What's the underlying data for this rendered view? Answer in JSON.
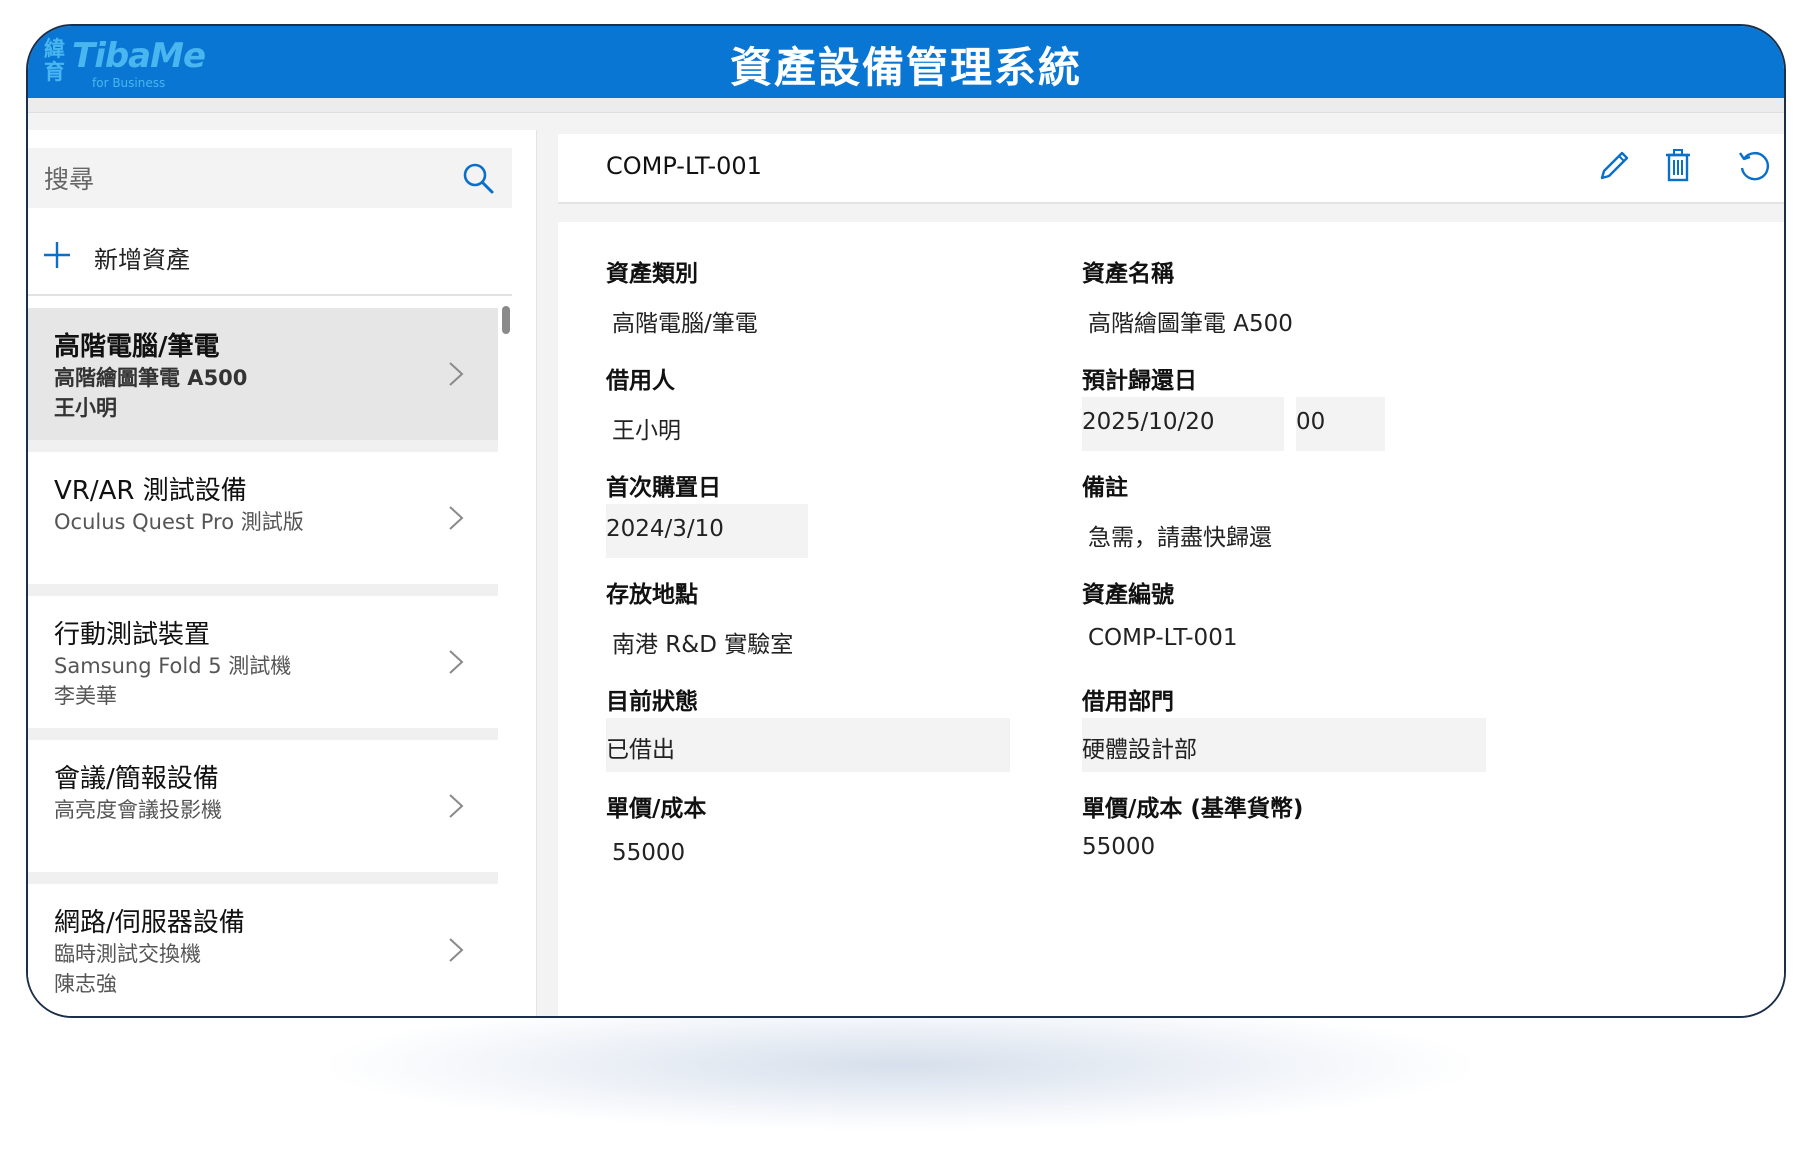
{
  "header": {
    "logo_cjk": "緯育",
    "logo_name": "TibaMe",
    "logo_sub": "for Business",
    "title": "資產設備管理系統"
  },
  "sidebar": {
    "search_placeholder": "搜尋",
    "search_icon": "search-icon",
    "add_label": "新增資產",
    "items": [
      {
        "title": "高階電腦/筆電",
        "subtitle": "高階繪圖筆電 A500",
        "user": "王小明",
        "selected": true
      },
      {
        "title": "VR/AR 測試設備",
        "subtitle": "Oculus Quest Pro 測試版",
        "user": ""
      },
      {
        "title": "行動測試裝置",
        "subtitle": "Samsung Fold 5 測試機",
        "user": "李美華"
      },
      {
        "title": "會議/簡報設備",
        "subtitle": "高亮度會議投影機",
        "user": ""
      },
      {
        "title": "網路/伺服器設備",
        "subtitle": "臨時測試交換機",
        "user": "陳志強"
      }
    ]
  },
  "record": {
    "id": "COMP-LT-001",
    "tools": [
      "edit-pencil-icon",
      "delete-trash-icon",
      "refresh-icon"
    ]
  },
  "fields": {
    "category_label": "資產類別",
    "category_value": "高階電腦/筆電",
    "name_label": "資產名稱",
    "name_value": "高階繪圖筆電 A500",
    "borrower_label": "借用人",
    "borrower_value": "王小明",
    "due_label": "預計歸還日",
    "due_date": "2025/10/20",
    "due_time": "00",
    "purchase_label": "首次購置日",
    "purchase_value": "2024/3/10",
    "note_label": "備註",
    "note_value": "急需，請盡快歸還",
    "location_label": "存放地點",
    "location_value": "南港 R&D 實驗室",
    "asset_no_label": "資產編號",
    "asset_no_value": "COMP-LT-001",
    "status_label": "目前狀態",
    "status_value": "已借出",
    "dept_label": "借用部門",
    "dept_value": "硬體設計部",
    "cost_label": "單價/成本",
    "cost_value": "55000",
    "cost_base_label": "單價/成本 (基準貨幣)",
    "cost_base_value": "55000"
  },
  "colors": {
    "accent": "#0a76d3",
    "logo": "#49b6f0",
    "selected_row": "#e6e6e6"
  }
}
